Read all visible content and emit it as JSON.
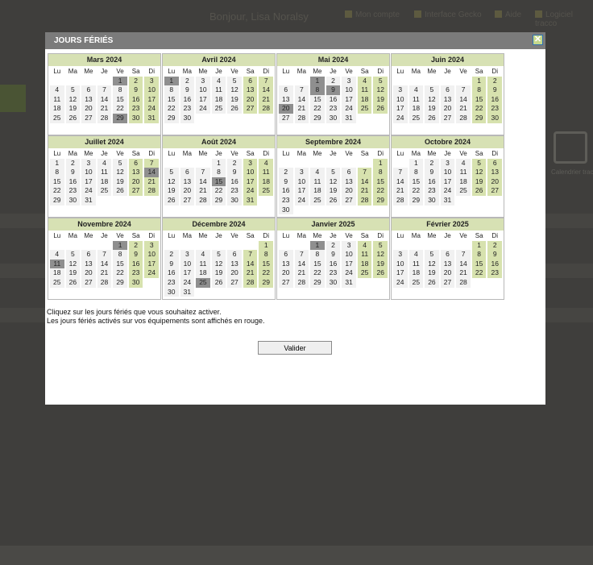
{
  "background": {
    "greeting": "Bonjour, Lisa Noralsy",
    "links": [
      "Mon compte",
      "Interface Gecko",
      "Aide",
      "Logiciel tracco"
    ],
    "calendar_label": "Calendrier trac"
  },
  "modal": {
    "title": "JOURS FÉRIÉS",
    "info_line1": "Cliquez sur les jours fériés que vous souhaitez activer.",
    "info_line2": "Les jours fériés activés sur vos équipements sont affichés en rouge.",
    "valider_label": "Valider"
  },
  "weekdays": [
    "Lu",
    "Ma",
    "Me",
    "Je",
    "Ve",
    "Sa",
    "Di"
  ],
  "months": [
    {
      "name": "Mars 2024",
      "offset": 4,
      "days": 31,
      "holidays": [
        1,
        29
      ]
    },
    {
      "name": "Avril 2024",
      "offset": 0,
      "days": 30,
      "holidays": [
        1
      ]
    },
    {
      "name": "Mai 2024",
      "offset": 2,
      "days": 31,
      "holidays": [
        1,
        8,
        9,
        20
      ]
    },
    {
      "name": "Juin 2024",
      "offset": 5,
      "days": 30,
      "holidays": []
    },
    {
      "name": "Juillet 2024",
      "offset": 0,
      "days": 31,
      "holidays": [
        14
      ]
    },
    {
      "name": "Août 2024",
      "offset": 3,
      "days": 31,
      "holidays": [
        15
      ]
    },
    {
      "name": "Septembre 2024",
      "offset": 6,
      "days": 30,
      "holidays": []
    },
    {
      "name": "Octobre 2024",
      "offset": 1,
      "days": 31,
      "holidays": []
    },
    {
      "name": "Novembre 2024",
      "offset": 4,
      "days": 30,
      "holidays": [
        1,
        11
      ]
    },
    {
      "name": "Décembre 2024",
      "offset": 6,
      "days": 31,
      "holidays": [
        25
      ]
    },
    {
      "name": "Janvier 2025",
      "offset": 2,
      "days": 31,
      "holidays": [
        1
      ]
    },
    {
      "name": "Février 2025",
      "offset": 5,
      "days": 28,
      "holidays": []
    }
  ],
  "colors": {
    "weekend": "#d7e2ae",
    "weekday": "#f1f1f1",
    "holiday": "#8f8f8f",
    "title_bar": "#7b7b7b",
    "month_header": "#d7e1b4"
  }
}
